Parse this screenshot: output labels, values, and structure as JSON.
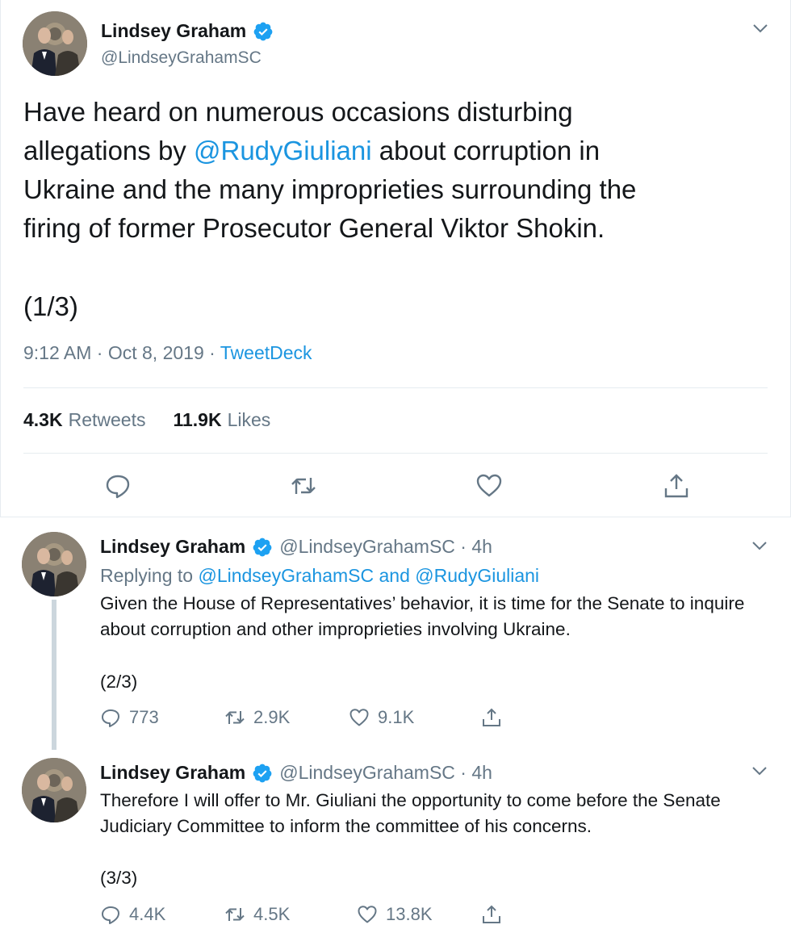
{
  "main_tweet": {
    "author_name": "Lindsey Graham",
    "author_handle": "@LindseyGrahamSC",
    "text_before": "Have heard on numerous occasions disturbing\nallegations by ",
    "mention": "@RudyGiuliani",
    "text_after": " about corruption in\nUkraine and the many improprieties surrounding the\nfiring of former Prosecutor General Viktor Shokin.",
    "part": "(1/3)",
    "timestamp": "9:12 AM · Oct 8, 2019 · ",
    "source": "TweetDeck",
    "retweets_count": "4.3K",
    "retweets_label": "Retweets",
    "likes_count": "11.9K",
    "likes_label": "Likes",
    "icons": [
      "reply-icon",
      "retweet-icon",
      "like-icon",
      "share-icon",
      "verified-badge-icon",
      "chevron-down-icon"
    ]
  },
  "replies": [
    {
      "author_name": "Lindsey Graham",
      "author_handle_time": "@LindseyGrahamSC · 4h",
      "replying_prefix": "Replying to ",
      "replying_to": "@LindseyGrahamSC and @RudyGiuliani",
      "text": "Given the House of Representatives’ behavior, it is time for the Senate to inquire about corruption and other improprieties involving Ukraine.",
      "part": "(2/3)",
      "reply_count": "773",
      "retweet_count": "2.9K",
      "like_count": "9.1K"
    },
    {
      "author_name": "Lindsey Graham",
      "author_handle_time": "@LindseyGrahamSC · 4h",
      "text": "Therefore I will offer to Mr. Giuliani the opportunity to come before the Senate Judiciary Committee to inform the committee of his concerns.",
      "part": "(3/3)",
      "reply_count": "4.4K",
      "retweet_count": "4.5K",
      "like_count": "13.8K"
    }
  ],
  "colors": {
    "link": "#1b95e0",
    "secondary_text": "#657786",
    "primary_text": "#14171a",
    "divider": "#e6ecf0",
    "thread_line": "#ccd6dd"
  }
}
